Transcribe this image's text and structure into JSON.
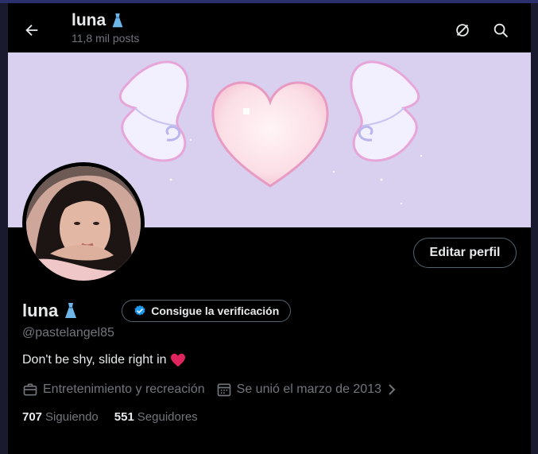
{
  "header": {
    "title": "luna",
    "title_emoji": "dress-icon",
    "subtitle": "11,8 mil posts",
    "icons": [
      "back-arrow-icon",
      "circle-slash-icon",
      "search-icon"
    ]
  },
  "profile": {
    "name": "luna",
    "handle": "@pastelangel85",
    "verify_label": "Consigue la verificación",
    "edit_label": "Editar perfil",
    "bio": "Don't be shy, slide right in",
    "bio_emoji": "red-heart-icon",
    "category": "Entretenimiento y recreación",
    "joined": "Se unió el marzo de 2013",
    "following_count": "707",
    "following_label": "Siguiendo",
    "followers_count": "551",
    "followers_label": "Seguidores"
  },
  "colors": {
    "background": "#000000",
    "text_primary": "#e7e9ea",
    "text_secondary": "#71767b",
    "verified_blue": "#1d9bf0",
    "banner_lavender": "#d9cfee",
    "heart_red": "#e0245e"
  }
}
